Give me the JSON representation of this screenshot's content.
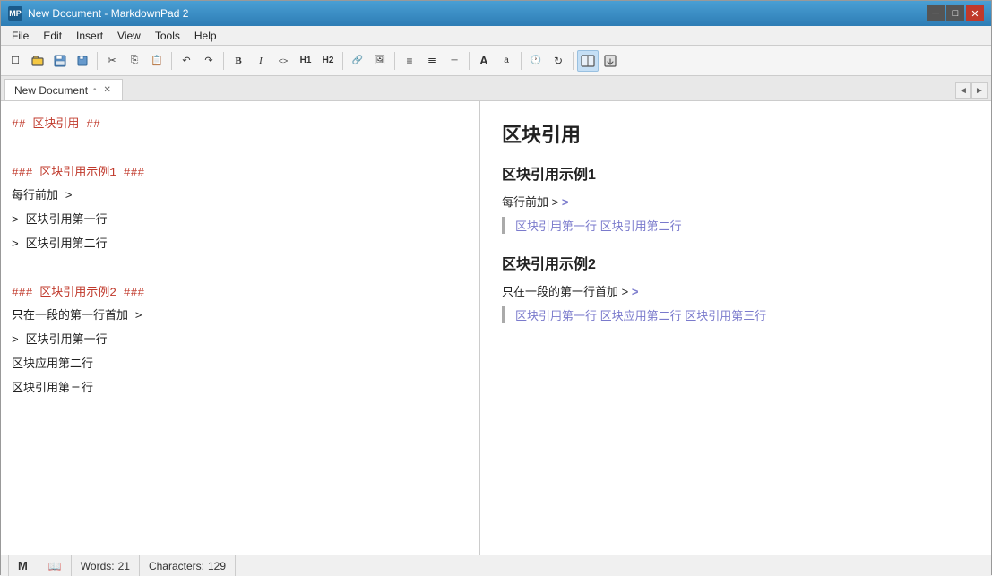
{
  "titlebar": {
    "app_name": "New Document - MarkdownPad 2",
    "app_icon_text": "MP",
    "controls": {
      "minimize": "─",
      "maximize": "□",
      "close": "✕"
    }
  },
  "menubar": {
    "items": [
      "File",
      "Edit",
      "Insert",
      "View",
      "Tools",
      "Help"
    ]
  },
  "toolbar": {
    "buttons": [
      {
        "name": "new",
        "icon": "☐"
      },
      {
        "name": "open",
        "icon": "📂"
      },
      {
        "name": "save",
        "icon": "💾"
      },
      {
        "name": "save-all",
        "icon": "💾"
      },
      {
        "name": "cut",
        "icon": "✂"
      },
      {
        "name": "copy",
        "icon": "⎘"
      },
      {
        "name": "paste",
        "icon": "📋"
      },
      {
        "name": "undo",
        "icon": "↶"
      },
      {
        "name": "redo",
        "icon": "↷"
      },
      {
        "name": "bold",
        "icon": "B"
      },
      {
        "name": "italic",
        "icon": "I"
      },
      {
        "name": "code",
        "icon": "<>"
      },
      {
        "name": "h1",
        "icon": "H1"
      },
      {
        "name": "h2",
        "icon": "H2"
      },
      {
        "name": "link",
        "icon": "🔗"
      },
      {
        "name": "image",
        "icon": "🖼"
      },
      {
        "name": "ul",
        "icon": "≡"
      },
      {
        "name": "ol",
        "icon": "≣"
      },
      {
        "name": "hr",
        "icon": "─"
      },
      {
        "name": "larger",
        "icon": "A"
      },
      {
        "name": "smaller",
        "icon": "a"
      },
      {
        "name": "clock",
        "icon": "🕐"
      },
      {
        "name": "refresh",
        "icon": "↻"
      },
      {
        "name": "preview-sync",
        "icon": "⊞"
      },
      {
        "name": "export",
        "icon": "⬛"
      }
    ]
  },
  "tabs": {
    "active": "New Document",
    "items": [
      {
        "label": "New Document",
        "modified": true
      }
    ],
    "nav": {
      "left": "◄",
      "right": "►"
    }
  },
  "editor": {
    "lines": [
      {
        "type": "h2",
        "text": "## 区块引用 ##"
      },
      {
        "type": "blank",
        "text": ""
      },
      {
        "type": "h3",
        "text": "### 区块引用示例1 ###"
      },
      {
        "type": "normal",
        "text": "每行前加 >"
      },
      {
        "type": "quote",
        "text": "> 区块引用第一行"
      },
      {
        "type": "quote",
        "text": "> 区块引用第二行"
      },
      {
        "type": "blank",
        "text": ""
      },
      {
        "type": "h3",
        "text": "### 区块引用示例2 ###"
      },
      {
        "type": "normal",
        "text": "只在一段的第一行首加 >"
      },
      {
        "type": "quote",
        "text": "> 区块引用第一行"
      },
      {
        "type": "normal",
        "text": "  区块应用第二行"
      },
      {
        "type": "normal",
        "text": "  区块引用第三行"
      }
    ]
  },
  "preview": {
    "title": "区块引用",
    "sections": [
      {
        "heading": "区块引用示例1",
        "intro": "每行前加 >",
        "blockquote": "区块引用第一行 区块引用第二行"
      },
      {
        "heading": "区块引用示例2",
        "intro": "只在一段的第一行首加 >",
        "blockquote": "区块引用第一行 区块应用第二行 区块引用第三行"
      }
    ]
  },
  "statusbar": {
    "mode_icon": "M",
    "book_icon": "📖",
    "words_label": "Words:",
    "words_count": "21",
    "chars_label": "Characters:",
    "chars_count": "129"
  }
}
